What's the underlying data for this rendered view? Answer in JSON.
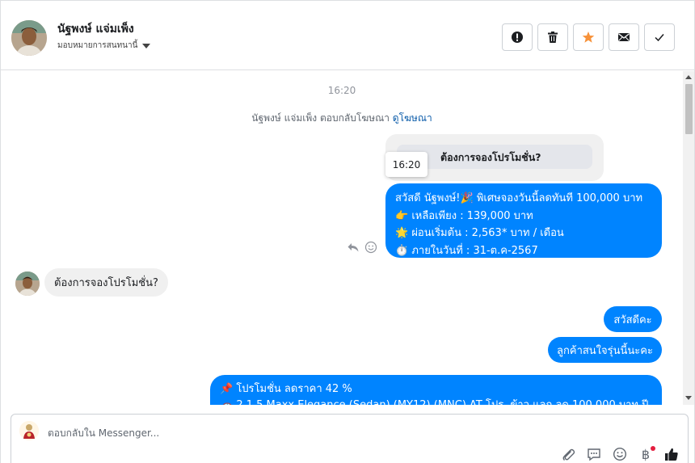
{
  "header": {
    "name": "นัฐพงษ์ แจ่มเพ็ง",
    "assign_label": "มอบหมายการสนทนานี้",
    "actions": [
      {
        "icon": "alert-icon",
        "label": "spam"
      },
      {
        "icon": "trash-icon",
        "label": "delete"
      },
      {
        "icon": "star-icon",
        "label": "star"
      },
      {
        "icon": "mail-icon",
        "label": "mark-unread"
      },
      {
        "icon": "check-icon",
        "label": "done"
      }
    ],
    "star_color": "#f7923a"
  },
  "chat": {
    "timestamp": "16:20",
    "reply_note": "นัฐพงษ์ แจ่มเพ็ง ตอบกลับโฆษณา",
    "reply_link": "ดูโฆษณา",
    "quoted_text": "ต้องการจองโปรโมชั่น?",
    "tooltip_time": "16:20",
    "promo1_lines": [
      "สวัสดี นัฐพงษ์!🎉 พิเศษจองวันนี้ลดทันที 100,000 บาท",
      "👉 เหลือเพียง : 139,000 บาท",
      "🌟 ผ่อนเริ่มต้น : 2,563* บาท / เดือน",
      "⏱️ ภายในวันที่ : 31-ต.ค-2567"
    ],
    "customer_message": "ต้องการจองโปรโมชั่น?",
    "hello_message": "สวัสดีคะ",
    "interest_message": "ลูกค้าสนใจรุ่นนี้นะคะ",
    "promo2_lines": [
      "📌 โปรโมชั่น ลดราคา 42 %",
      "🚗 2.1.5 Maxx Elegance (Sedan) (MY12) (MNC) AT โปร. ข้าว แลก ลด 100,000 บาท ปี"
    ],
    "accent_color": "#0084ff"
  },
  "composer": {
    "placeholder": "ตอบกลับใน Messenger...",
    "tools": [
      "attach-icon",
      "saved-replies-icon",
      "emoji-icon",
      "baht-icon",
      "like-icon"
    ],
    "baht_symbol": "฿"
  }
}
